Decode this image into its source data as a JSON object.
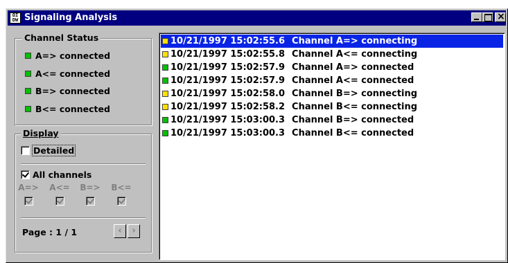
{
  "window": {
    "title": "Signaling Analysis",
    "app_icon_text": "ΩI DW"
  },
  "colors": {
    "green": "#00c000",
    "yellow": "#ffe000",
    "selection": "#0a24e6",
    "title_bar": "#000080"
  },
  "channel_status": {
    "legend": "Channel Status",
    "items": [
      {
        "label": "A=> connected",
        "color": "green"
      },
      {
        "label": "A<= connected",
        "color": "green"
      },
      {
        "label": "B=> connected",
        "color": "green"
      },
      {
        "label": "B<= connected",
        "color": "green"
      }
    ]
  },
  "display": {
    "legend": "Display",
    "detailed_label": "Detailed",
    "detailed_checked": false,
    "all_channels_label": "All channels",
    "all_channels_checked": true,
    "channels": [
      "A=>",
      "A<=",
      "B=>",
      "B<="
    ]
  },
  "pager": {
    "label": "Page : 1 / 1",
    "prev_icon": "‹",
    "next_icon": "›"
  },
  "log": [
    {
      "timestamp": "10/21/1997 15:02:55.6",
      "message": "Channel A=> connecting",
      "color": "yellow",
      "selected": true
    },
    {
      "timestamp": "10/21/1997 15:02:55.8",
      "message": "Channel A<= connecting",
      "color": "yellow",
      "selected": false
    },
    {
      "timestamp": "10/21/1997 15:02:57.9",
      "message": "Channel A=> connected",
      "color": "green",
      "selected": false
    },
    {
      "timestamp": "10/21/1997 15:02:57.9",
      "message": "Channel A<= connected",
      "color": "green",
      "selected": false
    },
    {
      "timestamp": "10/21/1997 15:02:58.0",
      "message": "Channel B=> connecting",
      "color": "yellow",
      "selected": false
    },
    {
      "timestamp": "10/21/1997 15:02:58.2",
      "message": "Channel B<= connecting",
      "color": "yellow",
      "selected": false
    },
    {
      "timestamp": "10/21/1997 15:03:00.3",
      "message": "Channel B=> connected",
      "color": "green",
      "selected": false
    },
    {
      "timestamp": "10/21/1997 15:03:00.3",
      "message": "Channel B<= connected",
      "color": "green",
      "selected": false
    }
  ]
}
